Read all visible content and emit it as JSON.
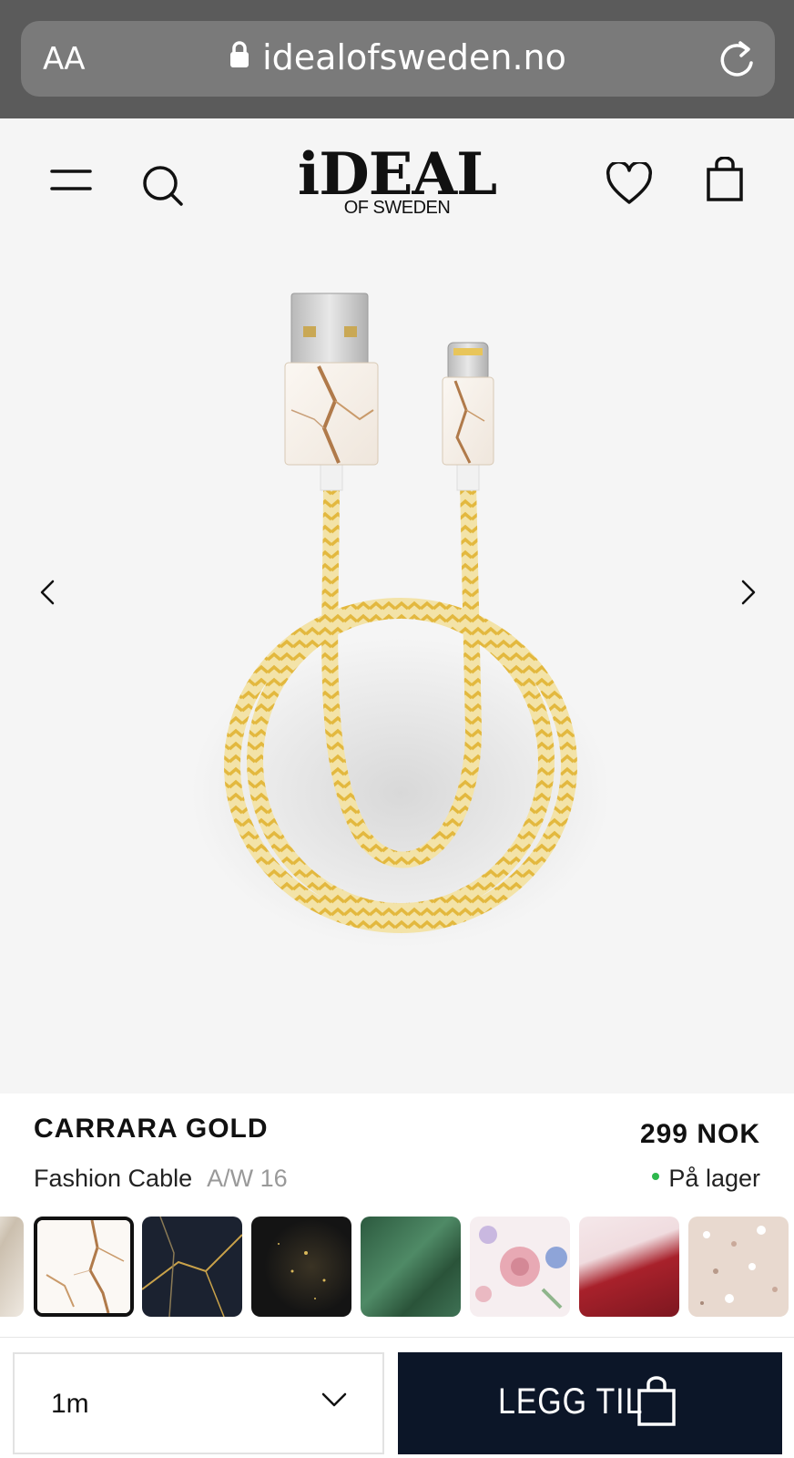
{
  "browser": {
    "text_size_label": "AA",
    "url": "idealofsweden.no"
  },
  "header": {
    "logo_main": "iDEAL",
    "logo_sub": "OF SWEDEN",
    "icons": [
      "menu-icon",
      "search-icon",
      "heart-icon",
      "bag-icon"
    ]
  },
  "product": {
    "title": "CARRARA GOLD",
    "price": "299 NOK",
    "type": "Fashion Cable",
    "season": "A/W 16",
    "stock": "På lager",
    "stock_color": "#2db84d"
  },
  "swatches": [
    {
      "name": "partial-marble",
      "selected": false
    },
    {
      "name": "carrara-gold",
      "selected": true
    },
    {
      "name": "port-laurent-marble",
      "selected": false
    },
    {
      "name": "black-gold-galaxy",
      "selected": false
    },
    {
      "name": "green-satin",
      "selected": false
    },
    {
      "name": "floral-romance",
      "selected": false
    },
    {
      "name": "red-gold-marble",
      "selected": false
    },
    {
      "name": "terrazzo",
      "selected": false
    }
  ],
  "purchase": {
    "size_value": "1m",
    "add_label": "LEGG TIL",
    "button_color": "#0c1628"
  }
}
